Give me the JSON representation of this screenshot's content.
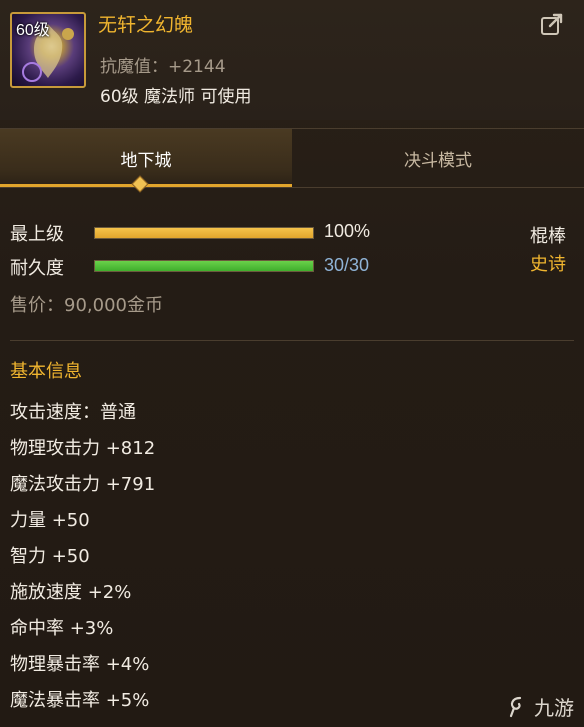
{
  "item": {
    "level_badge": "60级",
    "name": "无轩之幻魄",
    "stat_line": "抗魔值：+2144",
    "requirement": "60级 魔法师 可使用",
    "weapon_type": "棍棒",
    "rarity": "史诗",
    "rarity_color": "#f0b52f"
  },
  "tabs": [
    {
      "label": "地下城",
      "active": true
    },
    {
      "label": "决斗模式",
      "active": false
    }
  ],
  "bars": {
    "max_level": {
      "label": "最上级",
      "value": "100%",
      "fill": 1.0,
      "color": "#e2a52c"
    },
    "durability": {
      "label": "耐久度",
      "value": "30/30",
      "fill": 1.0,
      "color": "#3fae2c",
      "value_color": "#8fb3d6"
    }
  },
  "price": "售价：90,000金币",
  "basic_info": {
    "title": "基本信息",
    "lines": [
      "攻击速度：普通",
      "物理攻击力 +812",
      "魔法攻击力 +791",
      "力量 +50",
      "智力 +50",
      "施放速度 +2%",
      "命中率 +3%",
      "物理暴击率 +4%",
      "魔法暴击率 +5%"
    ]
  },
  "watermark": "九游"
}
